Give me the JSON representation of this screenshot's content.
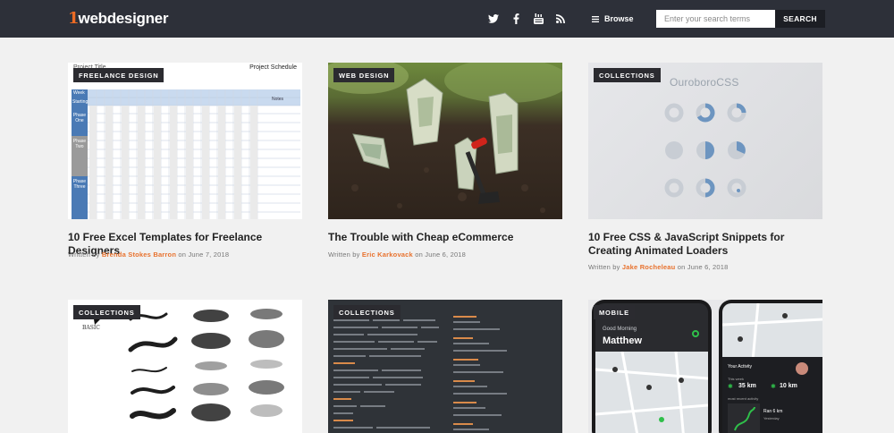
{
  "header": {
    "logo_prefix": "1",
    "logo_word": "webdesigner",
    "social_icons": [
      "twitter-icon",
      "facebook-icon",
      "youtube-icon",
      "rss-icon"
    ],
    "browse_label": "Browse",
    "search_placeholder": "Enter your search terms",
    "search_button": "SEARCH"
  },
  "byline_prefix": "Written by",
  "byline_on": "on",
  "colors": {
    "topbar": "#2d3039",
    "accent": "#e8722e",
    "badge": "#2b2b30",
    "background": "#f1f1f1"
  },
  "articles": [
    {
      "category": "FREELANCE DESIGN",
      "title": "10 Free Excel Templates for Freelance Designers",
      "author": "Brenda Stokes Barron",
      "date": "June 7, 2018",
      "thumb": {
        "sheet_title": "Project Title",
        "sheet_header": "Project Schedule",
        "row_week": "Week",
        "row_start": "Starting",
        "phases": [
          "Phase One",
          "Phase Two",
          "Phase Three"
        ],
        "notes": "Notes"
      }
    },
    {
      "category": "WEB DESIGN",
      "title": "The Trouble with Cheap eCommerce",
      "author": "Eric Karkovack",
      "date": "June 6, 2018"
    },
    {
      "category": "COLLECTIONS",
      "title": "10 Free CSS & JavaScript Snippets for Creating Animated Loaders",
      "author": "Jake Rocheleau",
      "date": "June 6, 2018",
      "thumb": {
        "brand": "OuroboroCSS"
      }
    },
    {
      "category": "COLLECTIONS",
      "thumb": {
        "label": "BASIC"
      }
    },
    {
      "category": "COLLECTIONS"
    },
    {
      "category": "MOBILE",
      "thumb": {
        "greeting": "Good Morning",
        "name": "Matthew",
        "activity": "Your Activity",
        "week": "This week",
        "run": "35 km",
        "ride": "10 km",
        "recent": "most recent activity",
        "ran": "Ran 6 km",
        "yesterday": "Yesterday"
      }
    }
  ]
}
